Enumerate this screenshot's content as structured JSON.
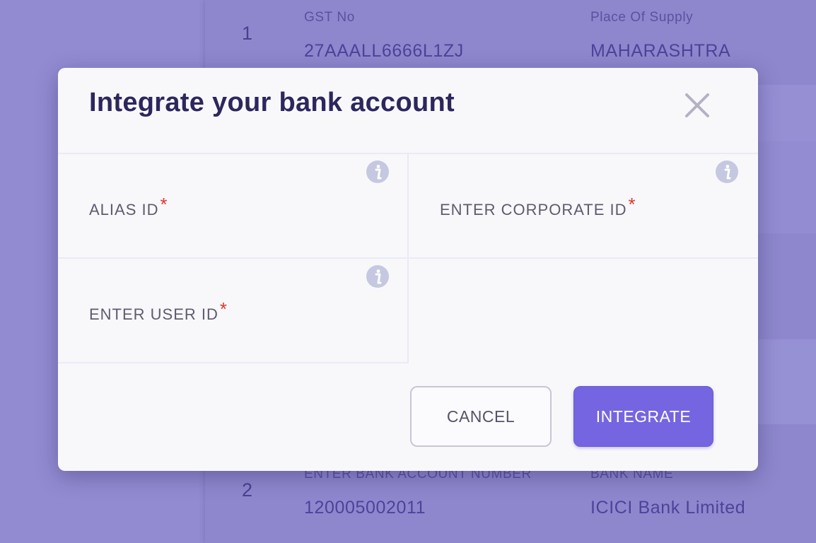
{
  "background": {
    "rows": [
      {
        "number": "1",
        "left_label": "GST No",
        "left_value": "27AAALL6666L1ZJ",
        "right_label": "Place Of Supply",
        "right_value": "MAHARASHTRA"
      },
      {
        "number": "2",
        "left_label": "ENTER BANK ACCOUNT NUMBER",
        "left_value": "120005002011",
        "right_label": "BANK NAME",
        "right_value": "ICICI Bank Limited"
      }
    ]
  },
  "dialog": {
    "title": "Integrate your bank account",
    "close_icon": "close-icon",
    "fields": [
      {
        "label": "ALIAS ID",
        "required_mark": "*",
        "value": ""
      },
      {
        "label": "ENTER CORPORATE ID",
        "required_mark": "*",
        "value": ""
      },
      {
        "label": "ENTER USER ID",
        "required_mark": "*",
        "value": ""
      }
    ],
    "info_icon": "info-icon",
    "buttons": {
      "cancel_label": "CANCEL",
      "integrate_label": "INTEGRATE"
    }
  },
  "colors": {
    "overlay_bg": "#9089cf",
    "dialog_bg": "#f8f8fb",
    "title_text": "#2c275c",
    "required_mark": "#e0362c",
    "primary_button": "#7565e0",
    "info_icon": "#c5c8e0"
  }
}
